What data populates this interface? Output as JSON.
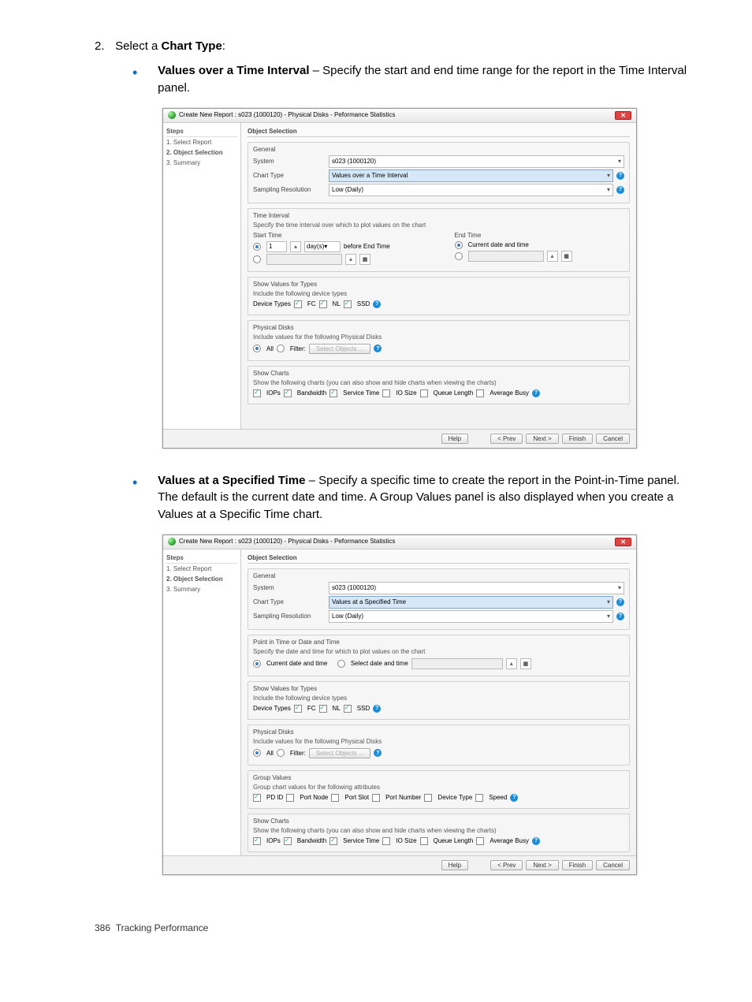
{
  "step": {
    "number": "2.",
    "text": "Select a ",
    "bold": "Chart Type",
    "after": ":"
  },
  "bullets": [
    {
      "title": "Values over a Time Interval",
      "desc": " – Specify the start and end time range for the report in the Time Interval panel."
    },
    {
      "title": "Values at a Specified Time",
      "desc": " – Specify a specific time to create the report in the Point-in-Time panel. The default is the current date and time. A Group Values panel is also displayed when you create a Values at a Specific Time chart."
    }
  ],
  "dialog": {
    "title": "Create New Report : s023 (1000120) - Physical Disks - Peformance Statistics",
    "stepsHeader": "Steps",
    "steps": [
      "1. Select Report",
      "2. Object Selection",
      "3. Summary"
    ],
    "panelTitle": "Object Selection",
    "general": {
      "header": "General",
      "systemLabel": "System",
      "systemValue": "s023 (1000120)",
      "chartTypeLabel": "Chart Type",
      "chartType1": "Values over a Time Interval",
      "chartType2": "Values at a Specified Time",
      "samplingLabel": "Sampling Resolution",
      "samplingValue": "Low (Daily)"
    },
    "timeInterval": {
      "header": "Time Interval",
      "sub": "Specify the time interval over which to plot values on the chart",
      "startHeader": "Start Time",
      "endHeader": "End Time",
      "startVal": "1",
      "startUnit": "day(s)",
      "beforeEnd": "before End Time",
      "currentDate": "Current date and time"
    },
    "pointInTime": {
      "header": "Point in Time or Date and Time",
      "sub": "Specify the date and time for which to plot values on the chart",
      "opt1": "Current date and time",
      "opt2": "Select date and time"
    },
    "showTypes": {
      "header": "Show Values for Types",
      "sub": "Include the following device types",
      "label": "Device Types",
      "opts": [
        "FC",
        "NL",
        "SSD"
      ]
    },
    "physDisks": {
      "header": "Physical Disks",
      "sub": "Include values for the following Physical Disks",
      "all": "All",
      "filter": "Filter:",
      "selectObjects": "Select Objects ..."
    },
    "groupValues": {
      "header": "Group Values",
      "sub": "Group chart values for the following attributes",
      "opts": [
        "PD ID",
        "Port Node",
        "Port Slot",
        "Port Number",
        "Device Type",
        "Speed"
      ]
    },
    "showCharts": {
      "header": "Show Charts",
      "sub": "Show the following charts (you can also show and hide charts when viewing the charts)",
      "opts": [
        "IOPs",
        "Bandwidth",
        "Service Time",
        "IO Size",
        "Queue Length",
        "Average Busy"
      ]
    },
    "buttons": {
      "help": "Help",
      "prev": "< Prev",
      "next": "Next >",
      "finish": "Finish",
      "cancel": "Cancel"
    }
  },
  "footer": {
    "pageNum": "386",
    "section": "Tracking Performance"
  }
}
